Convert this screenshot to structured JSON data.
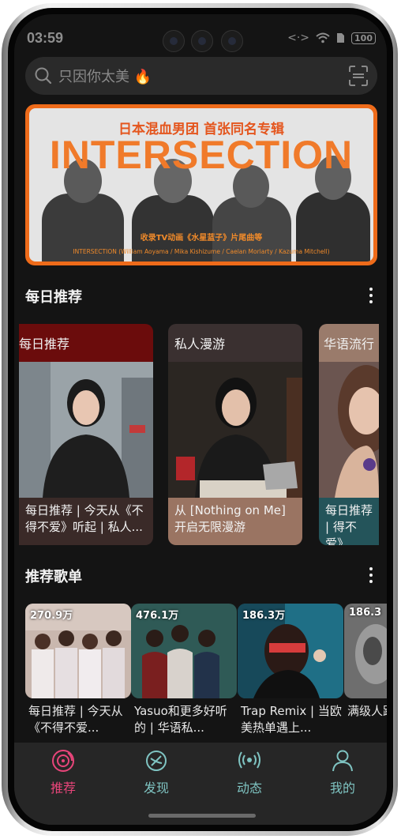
{
  "status_bar": {
    "time": "03:59",
    "battery": "100"
  },
  "search": {
    "placeholder": "只因你太美 🔥"
  },
  "banner": {
    "subtitle": "日本混血男团 首张同名专辑",
    "title": "INTERSECTION",
    "note": "收录TV动画《水星蓝子》片尾曲等",
    "credit": "INTERSECTION (William Aoyama / Mika Kishizume / Caelan Moriarty / Kazuma Mitchell)"
  },
  "daily": {
    "section_title": "每日推荐",
    "cards": [
      {
        "title": "每日推荐",
        "desc": "每日推荐 | 今天从《不得不爱》听起 | 私人...",
        "title_bg": "#6b0c0c",
        "desc_bg": "#3a2a28"
      },
      {
        "title": "私人漫游",
        "desc": "从 [Nothing on Me] 开启无限漫游",
        "title_bg": "#3a3030",
        "desc_bg": "#9a7462"
      },
      {
        "title": "华语流行",
        "desc": "每日推荐 | 得不爱》",
        "title_bg": "#9a7b6b",
        "desc_bg": "#24545a"
      }
    ]
  },
  "playlists": {
    "section_title": "推荐歌单",
    "items": [
      {
        "count": "270.9万",
        "text": "每日推荐 | 今天从《不得不爱..."
      },
      {
        "count": "476.1万",
        "text": "Yasuo和更多好听的 | 华语私..."
      },
      {
        "count": "186.3万",
        "text": "Trap Remix | 当欧美热单遇上..."
      },
      {
        "count": "186.3",
        "text": "满级人路必省"
      }
    ]
  },
  "tabbar": {
    "items": [
      {
        "label": "推荐",
        "icon": "disc-icon",
        "active": true
      },
      {
        "label": "发现",
        "icon": "planet-icon",
        "active": false
      },
      {
        "label": "动态",
        "icon": "broadcast-icon",
        "active": false
      },
      {
        "label": "我的",
        "icon": "user-icon",
        "active": false
      }
    ],
    "active_color": "#e8457a",
    "inactive_color": "#7fc4c2"
  }
}
